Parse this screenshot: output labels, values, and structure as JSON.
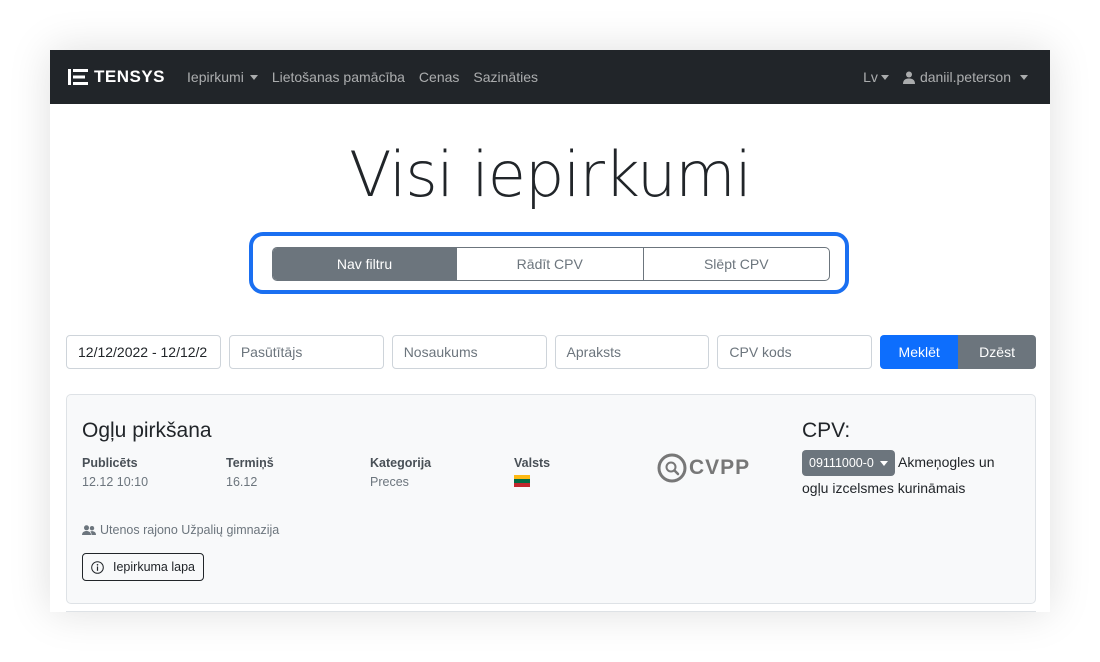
{
  "navbar": {
    "brand": "TENSYS",
    "items": [
      {
        "label": "Iepirkumi",
        "dropdown": true
      },
      {
        "label": "Lietošanas pamācība"
      },
      {
        "label": "Cenas"
      },
      {
        "label": "Sazināties"
      }
    ],
    "language": "Lv",
    "user": "daniil.peterson"
  },
  "hero": {
    "title": "Visi iepirkumi"
  },
  "view_toggle": {
    "options": [
      "Nav filtru",
      "Rādīt CPV",
      "Slēpt CPV"
    ],
    "active": "Nav filtru"
  },
  "filters": {
    "date_range": "12/12/2022 - 12/12/2",
    "customer_placeholder": "Pasūtītājs",
    "name_placeholder": "Nosaukums",
    "description_placeholder": "Apraksts",
    "cpv_placeholder": "CPV kods",
    "search_label": "Meklēt",
    "clear_label": "Dzēst"
  },
  "procurement": {
    "title": "Ogļu pirkšana",
    "published_label": "Publicēts",
    "published_value": "12.12 10:10",
    "deadline_label": "Termiņš",
    "deadline_value": "16.12",
    "category_label": "Kategorija",
    "category_value": "Preces",
    "country_label": "Valsts",
    "country_flag_colors": [
      "#FDB913",
      "#006A44",
      "#C1272D"
    ],
    "source_logo": "CVPP",
    "buyer": "Utenos rajono Užpalių gimnazija",
    "page_button": "Iepirkuma lapa",
    "cpv_title": "CPV:",
    "cpv_code": "09111000-0",
    "cpv_description": "Akmeņogles un ogļu izcelsmes kurināmais"
  },
  "colors": {
    "navbar_bg": "#212529",
    "primary": "#0d6efd",
    "secondary": "#6c757d",
    "highlight": "#1a6ff1"
  }
}
